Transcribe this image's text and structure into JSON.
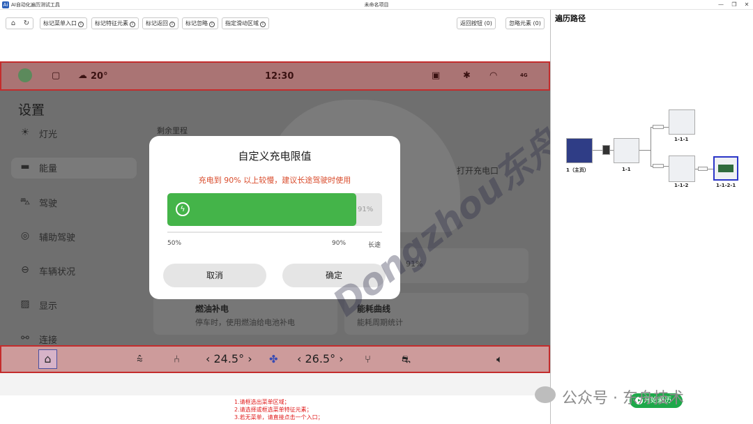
{
  "window": {
    "app_logo": "Ai",
    "app_title": "AI自动化遍历测试工具",
    "title": "未命名项目",
    "controls": [
      "—",
      "❐",
      "✕"
    ]
  },
  "toolbar": {
    "nav": {
      "home_icon": "⌂",
      "refresh_icon": "↻"
    },
    "buttons": [
      "标记菜单入口",
      "标记特征元素",
      "标记返回",
      "标记忽略",
      "指定滑动区域"
    ],
    "info_glyph": "i",
    "right_buttons": [
      {
        "label": "返回按钮",
        "count": "(0)"
      },
      {
        "label": "忽略元素",
        "count": "(0)"
      }
    ]
  },
  "statusbar": {
    "weather": "20°",
    "time": "12:30",
    "signal": "4G"
  },
  "settings": {
    "title": "设置",
    "menu": [
      {
        "icon": "☀",
        "label": "灯光"
      },
      {
        "icon": "▬",
        "label": "能量"
      },
      {
        "icon": "⛍",
        "label": "驾驶"
      },
      {
        "icon": "◎",
        "label": "辅助驾驶"
      },
      {
        "icon": "⊖",
        "label": "车辆状况"
      },
      {
        "icon": "▨",
        "label": "显示"
      },
      {
        "icon": "⚯",
        "label": "连接"
      }
    ],
    "range_label": "剩余里程",
    "open_port": "打开充电口",
    "percent_behind": "91%",
    "cards": [
      {
        "title": "燃油补电",
        "sub": "停车时，使用燃油给电池补电"
      },
      {
        "title": "能耗曲线",
        "sub": "能耗周期统计"
      }
    ]
  },
  "watermark": "Dongzhou东舟",
  "dialog": {
    "title": "自定义充电限值",
    "subtitle": "充电到 90% 以上较慢，建议长途驾驶时使用",
    "value": "91%",
    "fill": 0.88,
    "ticks": [
      "50%",
      "90%",
      "长途"
    ],
    "cancel": "取消",
    "confirm": "确定"
  },
  "bottombar": {
    "temp_left": "‹ 24.5° ›",
    "temp_right": "‹ 26.5° ›"
  },
  "hints": [
    "1.请框选出菜单区域；",
    "2.请选择或框选菜单特征元素；",
    "3.若无菜单，请直接点击一个入口；"
  ],
  "traversal": {
    "title": "遍历路径",
    "nodes": [
      {
        "label": "1（主页）"
      },
      {
        "label": "1-1"
      },
      {
        "label": "1-1-1"
      },
      {
        "label": "1-1-2"
      },
      {
        "label": "1-1-2-1"
      }
    ],
    "start_button": "开始遍历"
  },
  "overlay": {
    "wechat_label": "公众号 · 东舟技术"
  },
  "colors": {
    "accent_green": "#44b449",
    "highlight_red": "#c42c2c",
    "warning_text": "#d94b2b"
  }
}
